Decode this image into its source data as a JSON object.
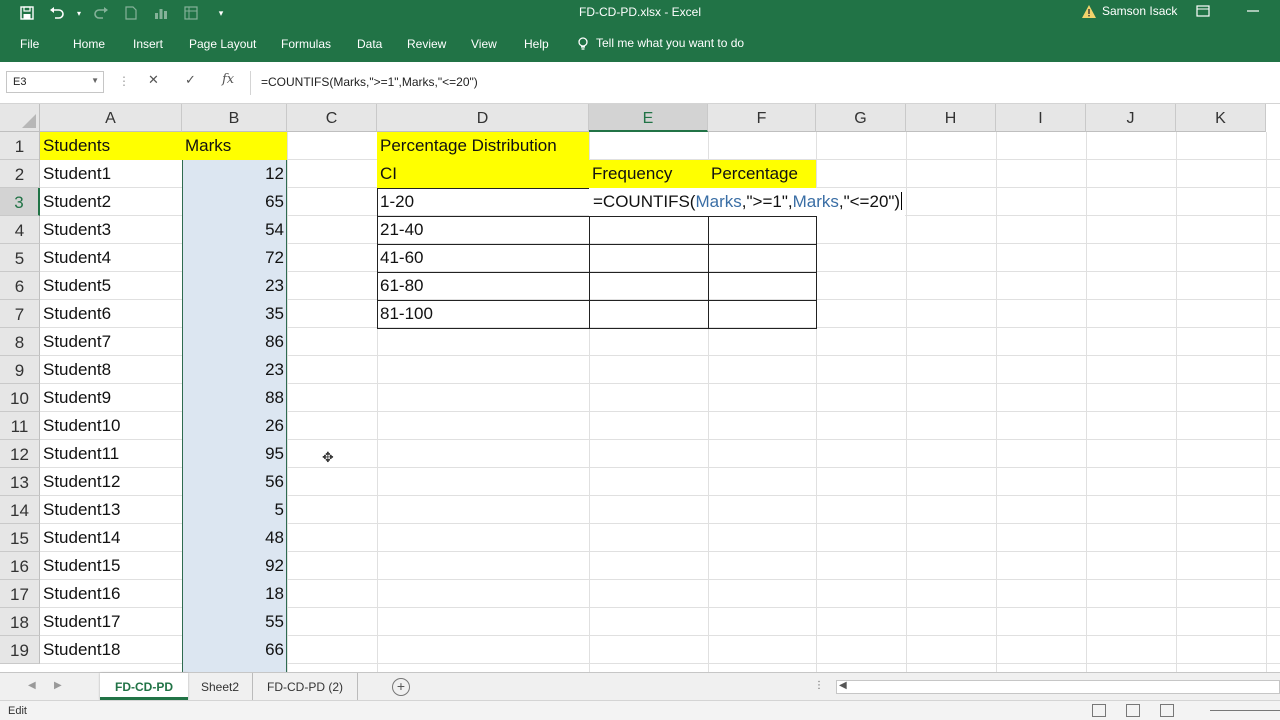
{
  "titlebar": {
    "title": "FD-CD-PD.xlsx  -  Excel",
    "user": "Samson Isack",
    "icons": [
      "save-icon",
      "undo-icon",
      "redo-icon",
      "new-file-icon",
      "chart-icon",
      "dropdown-icon"
    ]
  },
  "ribbon": {
    "tabs": [
      "File",
      "Home",
      "Insert",
      "Page Layout",
      "Formulas",
      "Data",
      "Review",
      "View",
      "Help"
    ],
    "tell_me": "Tell me what you want to do"
  },
  "formula_bar": {
    "name_box": "E3",
    "formula": "=COUNTIFS(Marks,\">=1\",Marks,\"<=20\")"
  },
  "columns": [
    "A",
    "B",
    "C",
    "D",
    "E",
    "F",
    "G",
    "H",
    "I",
    "J",
    "K"
  ],
  "rows": [
    "1",
    "2",
    "3",
    "4",
    "5",
    "6",
    "7",
    "8",
    "9",
    "10",
    "11",
    "12",
    "13",
    "14",
    "15",
    "16",
    "17",
    "18",
    "19"
  ],
  "students": {
    "header": "Students",
    "names": [
      "Student1",
      "Student2",
      "Student3",
      "Student4",
      "Student5",
      "Student6",
      "Student7",
      "Student8",
      "Student9",
      "Student10",
      "Student11",
      "Student12",
      "Student13",
      "Student14",
      "Student15",
      "Student16",
      "Student17",
      "Student18"
    ]
  },
  "marks": {
    "header": "Marks",
    "values": [
      "12",
      "65",
      "54",
      "72",
      "23",
      "35",
      "86",
      "23",
      "88",
      "26",
      "95",
      "56",
      "5",
      "48",
      "92",
      "18",
      "55",
      "66"
    ]
  },
  "distribution": {
    "title": "Percentage Distribution",
    "ci_header": "CI",
    "frequency_header": "Frequency",
    "percentage_header": "Percentage",
    "intervals": [
      "1-20",
      "21-40",
      "41-60",
      "61-80",
      "81-100"
    ]
  },
  "edit_cell": {
    "p1": "=COUNTIFS(",
    "ref1": "Marks",
    "p2": ",\">=1\",",
    "ref2": "Marks",
    "p3": ",\"<=20\")"
  },
  "sheets": {
    "tabs": [
      "FD-CD-PD",
      "Sheet2",
      "FD-CD-PD (2)"
    ],
    "active": "FD-CD-PD"
  },
  "status": {
    "mode": "Edit"
  }
}
